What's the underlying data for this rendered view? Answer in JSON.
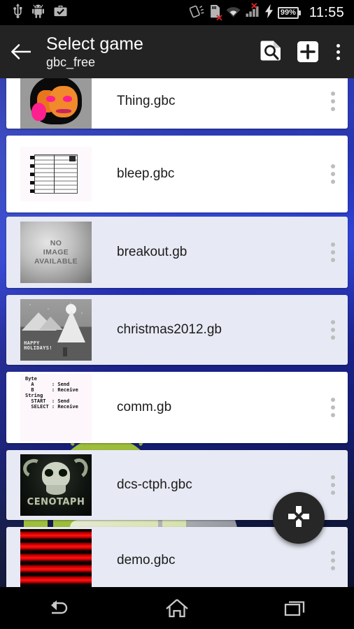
{
  "status_bar": {
    "left_icons": [
      {
        "name": "usb-icon",
        "label": "USB"
      },
      {
        "name": "android-icon",
        "label": "Android"
      },
      {
        "name": "briefcase-check-icon",
        "label": "Work profile"
      }
    ],
    "right_icons": [
      {
        "name": "rotation-lock-icon",
        "label": "Auto-rotate"
      },
      {
        "name": "sd-card-error-icon",
        "label": "SD card removed"
      },
      {
        "name": "wifi-icon",
        "label": "Wi-Fi"
      },
      {
        "name": "cell-signal-error-icon",
        "label": "No SIM"
      },
      {
        "name": "charging-bolt-icon",
        "label": "Charging"
      }
    ],
    "battery_level": "99%",
    "clock": "11:55"
  },
  "action_bar": {
    "back_label": "Back",
    "title": "Select game",
    "subtitle": "gbc_free",
    "actions": [
      {
        "name": "document-search-icon",
        "label": "Search"
      },
      {
        "name": "plus-box-icon",
        "label": "Add"
      },
      {
        "name": "overflow-menu-icon",
        "label": "More options"
      }
    ]
  },
  "list": {
    "items": [
      {
        "label": "Thing.gbc",
        "thumb": "thing-artwork",
        "tint": false,
        "overflow": "row-overflow-icon"
      },
      {
        "label": "bleep.gbc",
        "thumb": "bleep-tracker",
        "tint": false,
        "overflow": "row-overflow-icon"
      },
      {
        "label": "breakout.gb",
        "thumb": "no-image-available",
        "tint": true,
        "overflow": "row-overflow-icon"
      },
      {
        "label": "christmas2012.gb",
        "thumb": "christmas-scene",
        "tint": true,
        "overflow": "row-overflow-icon"
      },
      {
        "label": "comm.gb",
        "thumb": "comm-textscreen",
        "tint": false,
        "overflow": "row-overflow-icon"
      },
      {
        "label": "dcs-ctph.gbc",
        "thumb": "cenotaph-skull",
        "tint": true,
        "overflow": "row-overflow-icon"
      },
      {
        "label": "demo.gbc",
        "thumb": "red-stripes",
        "tint": true,
        "overflow": "row-overflow-icon"
      }
    ],
    "no_image_text": "NO\nIMAGE\nAVAILABLE",
    "comm_thumb_text": "Byte\n  A      : Send\n  B      : Receive\nString\n  START  : Send\n  SELECT : Receive",
    "christmas_thumb_text": "HAPPY\nHOLIDAYS!",
    "dcs_thumb_text": "CENOTAPH"
  },
  "fab": {
    "name": "dpad-icon",
    "label": "Gamepad controls"
  },
  "nav_bar": {
    "buttons": [
      {
        "name": "back-nav-icon",
        "label": "Back"
      },
      {
        "name": "home-nav-icon",
        "label": "Home"
      },
      {
        "name": "recents-nav-icon",
        "label": "Recents"
      }
    ]
  },
  "colors": {
    "action_bar_bg": "#232323",
    "status_bar_bg": "#000000",
    "wallpaper_blue": "#2535c8",
    "row_white": "#ffffff",
    "row_tint": "#e7e9f4",
    "fab_bg": "#272727",
    "android_green": "#a4c639",
    "error_red": "#e32020"
  }
}
